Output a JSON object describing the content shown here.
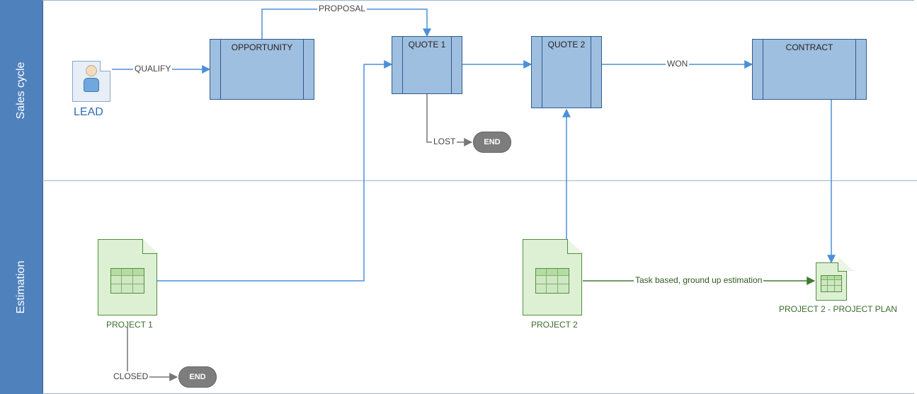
{
  "lanes": {
    "sales": "Sales cycle",
    "estimation": "Estimation"
  },
  "nodes": {
    "lead": "LEAD",
    "opportunity": "OPPORTUNITY",
    "quote1": "QUOTE 1",
    "quote2": "QUOTE 2",
    "contract": "CONTRACT",
    "end1": "END",
    "end2": "END",
    "project1": "PROJECT 1",
    "project2": "PROJECT 2",
    "project2plan": "PROJECT 2 - PROJECT PLAN"
  },
  "edges": {
    "qualify": "QUALIFY",
    "proposal": "PROPOSAL",
    "lost": "LOST",
    "won": "WON",
    "closed": "CLOSED",
    "task_est": "Task based, ground up estimation"
  },
  "colors": {
    "lane_fill": "#4f81bd",
    "box_fill": "#9fbfe0",
    "box_border": "#2f5b8f",
    "note_fill": "#ddf0d4",
    "note_border": "#4f8f3f",
    "edge_blue": "#4a90d9",
    "edge_gray": "#777777",
    "edge_green": "#3f7a30"
  }
}
